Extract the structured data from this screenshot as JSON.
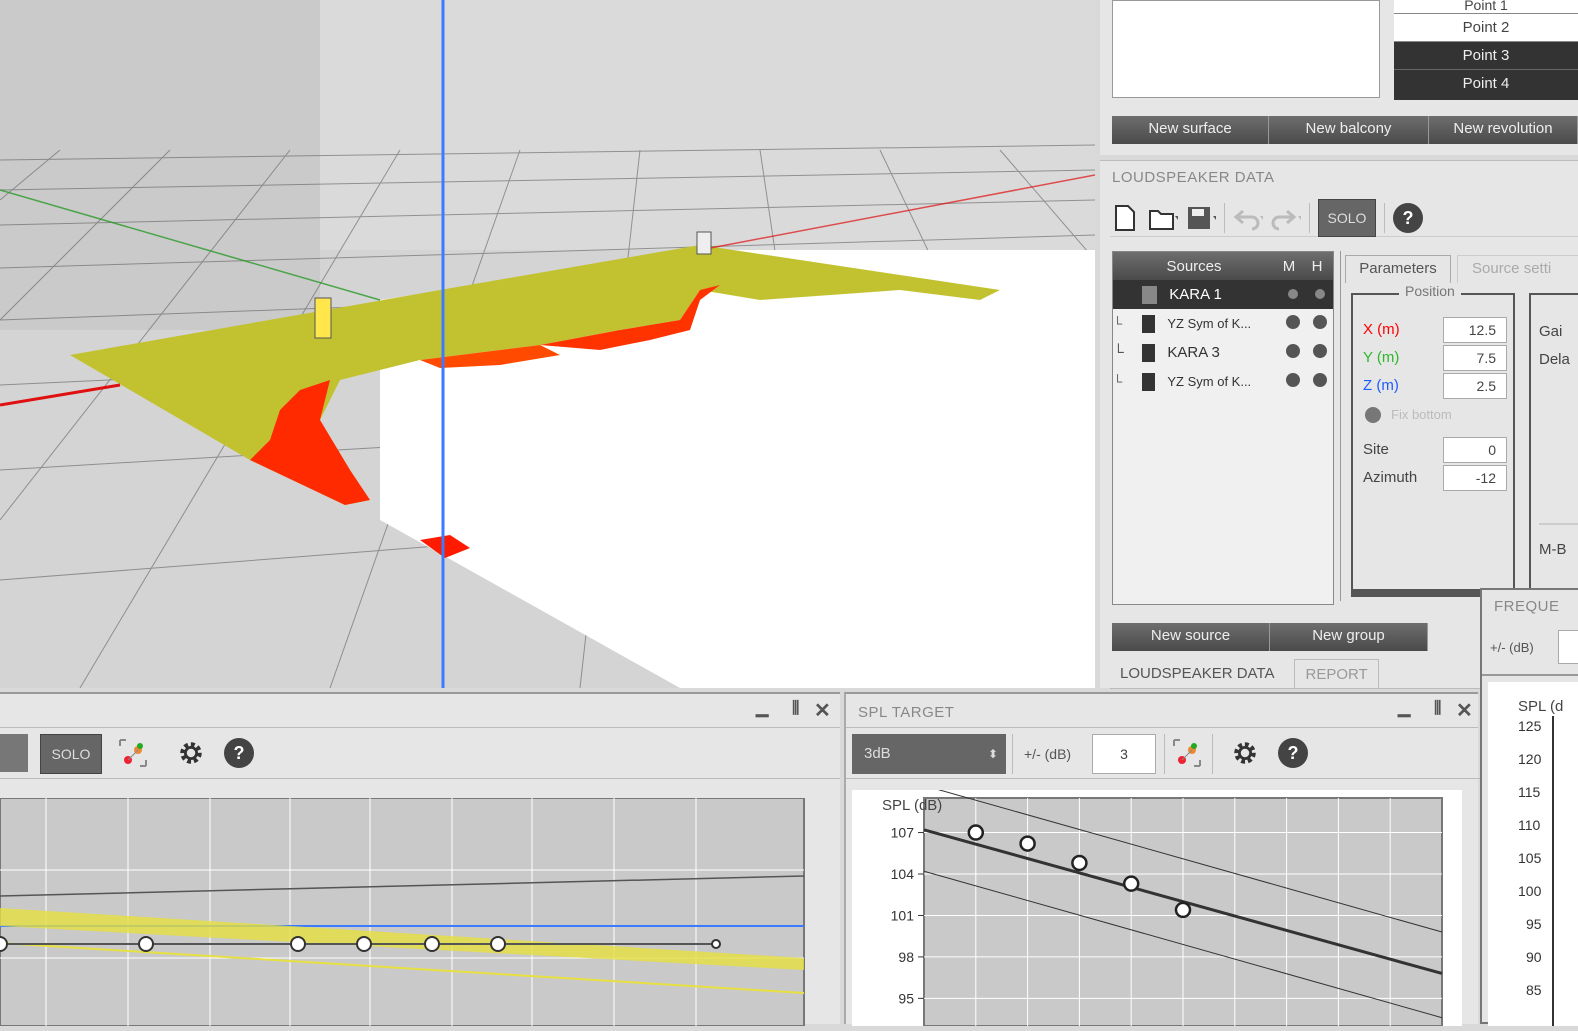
{
  "surfaces_panel": {
    "points": [
      "Point 1",
      "Point 2",
      "Point 3",
      "Point 4"
    ],
    "buttons": [
      "New surface",
      "New balcony",
      "New revolution"
    ]
  },
  "loudspeaker_data": {
    "title": "LOUDSPEAKER DATA",
    "solo_label": "SOLO",
    "sources_header": "Sources",
    "col_m": "M",
    "col_h": "H",
    "sources": [
      {
        "name": "KARA 1",
        "selected": true
      },
      {
        "name": "YZ Sym of K...",
        "selected": false
      },
      {
        "name": "KARA 3",
        "selected": false
      },
      {
        "name": "YZ Sym of K...",
        "selected": false
      }
    ],
    "tabs": {
      "parameters": "Parameters",
      "source_settings": "Source setti"
    },
    "position_group": "Position",
    "x_label": "X (m)",
    "x_value": "12.5",
    "y_label": "Y (m)",
    "y_value": "7.5",
    "z_label": "Z (m)",
    "z_value": "2.5",
    "fix_bottom": "Fix bottom",
    "site_label": "Site",
    "site_value": "0",
    "azimuth_label": "Azimuth",
    "azimuth_value": "-12",
    "gain_label": "Gai",
    "delay_label": "Dela",
    "mb_label": "M-B",
    "new_source": "New source",
    "new_group": "New group",
    "bottom_tabs": [
      "LOUDSPEAKER DATA",
      "REPORT"
    ],
    "colors": {
      "x": "#ff0000",
      "y": "#2bb82b",
      "z": "#1e5bff"
    }
  },
  "left_bottom_panel": {
    "solo_label": "SOLO"
  },
  "spl_target": {
    "title": "SPL TARGET",
    "select_value": "3dB",
    "tolerance_label": "+/- (dB)",
    "tolerance_value": "3"
  },
  "frequency_panel": {
    "title": "FREQUE",
    "tolerance_label": "+/- (dB)",
    "axis_label": "SPL (d",
    "ticks": [
      "125",
      "120",
      "115",
      "110",
      "105",
      "100",
      "95",
      "90",
      "85"
    ]
  },
  "chart_data": {
    "type": "scatter",
    "ylabel": "SPL (dB)",
    "y_ticks": [
      107,
      104,
      101,
      98,
      95
    ],
    "points": [
      [
        1,
        107
      ],
      [
        2,
        106.2
      ],
      [
        3,
        104.8
      ],
      [
        4,
        103.3
      ],
      [
        5,
        101.4
      ]
    ],
    "target_line": [
      [
        0,
        107.2
      ],
      [
        10,
        96.8
      ]
    ],
    "upper_line": [
      [
        0,
        110.4
      ],
      [
        10,
        99.8
      ]
    ],
    "lower_line": [
      [
        0,
        104.2
      ],
      [
        10,
        93.6
      ]
    ]
  },
  "viewport_colors": {
    "floor": "#ffffff",
    "coverage_high": "#c9c72a",
    "coverage_low": "#ff1a00",
    "axis_z": "#3a7bff",
    "axis_x": "#e01010",
    "axis_y": "#2a9a2a"
  }
}
